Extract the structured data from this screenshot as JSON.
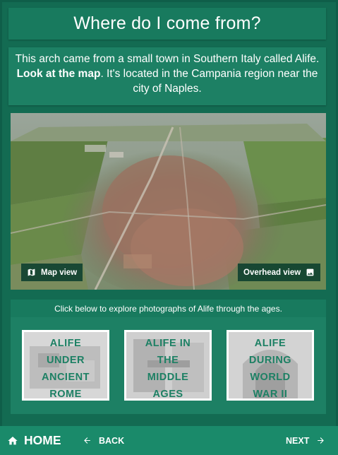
{
  "title": "Where do I come from?",
  "intro": {
    "part1": "This arch came from a small town in Southern Italy called Alife.",
    "bold": "Look at the map",
    "part2": ". It's located in the Campania region near the city of Naples."
  },
  "map": {
    "map_view_label": "Map view",
    "map_view_icon": "map-icon",
    "overhead_view_label": "Overhead view",
    "overhead_view_icon": "image-icon"
  },
  "explore": {
    "header": "Click below to explore photographs of Alife through the ages.",
    "tiles": [
      {
        "lines": [
          "ALIFE",
          "UNDER",
          "ANCIENT",
          "ROME"
        ]
      },
      {
        "lines": [
          "ALIFE IN",
          "THE",
          "MIDDLE",
          "AGES"
        ]
      },
      {
        "lines": [
          "ALIFE",
          "DURING",
          "WORLD",
          "WAR II"
        ]
      }
    ]
  },
  "nav": {
    "home_label": "HOME",
    "home_icon": "home-icon",
    "back_label": "BACK",
    "back_icon": "arrow-left-icon",
    "next_label": "NEXT",
    "next_icon": "arrow-right-icon"
  },
  "colors": {
    "background": "#0f5e49",
    "panel": "#136b52",
    "accent": "#1d8064",
    "nav": "#1a8a6a"
  }
}
